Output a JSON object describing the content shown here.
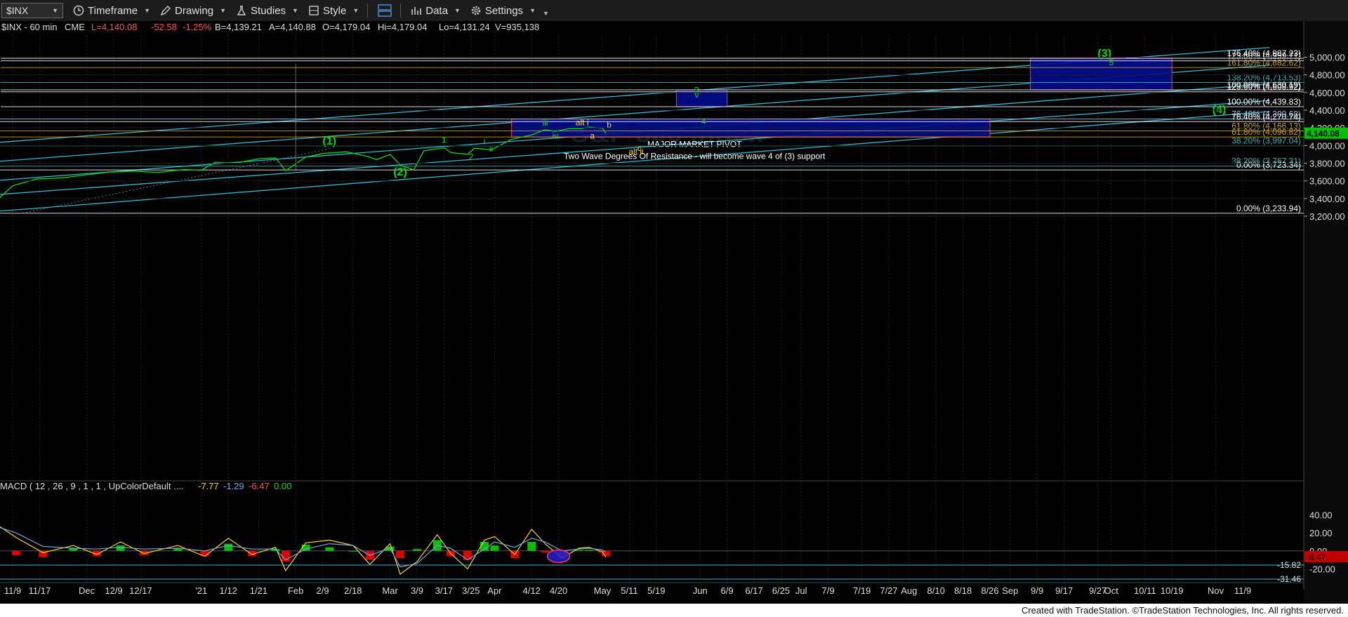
{
  "toolbar": {
    "symbol": "$INX",
    "timeframe": "Timeframe",
    "drawing": "Drawing",
    "studies": "Studies",
    "style": "Style",
    "data": "Data",
    "settings": "Settings"
  },
  "header": {
    "symbol": "$INX - 60 min",
    "exchange": "CME",
    "last": "L=4,140.08",
    "change": "-52.58",
    "pct": "-1.25%",
    "bid": "B=4,139.21",
    "ask": "A=4,140.88",
    "open": "O=4,179.04",
    "high": "Hi=4,179.04",
    "low": "Lo=4,131.24",
    "volume": "V=935,138"
  },
  "watermark": "S&P 500 Index",
  "current_price": "4,140.08",
  "footer": "Created with TradeStation. ©TradeStation Technologies, Inc. All rights reserved.",
  "chart_data": {
    "type": "line",
    "instrument": "$INX",
    "interval": "60 min",
    "ylim": [
      3130,
      5090
    ],
    "y_ticks": [
      "5,000.00",
      "4,800.00",
      "4,600.00",
      "4,400.00",
      "4,200.00",
      "4,000.00",
      "3,800.00",
      "3,600.00",
      "3,400.00",
      "3,200.00"
    ],
    "x_ticks": [
      "11/9",
      "11/17",
      "Dec",
      "12/9",
      "12/17",
      "'21",
      "1/12",
      "1/21",
      "Feb",
      "2/9",
      "2/18",
      "Mar",
      "3/9",
      "3/17",
      "3/25",
      "Apr",
      "4/12",
      "4/20",
      "May",
      "5/11",
      "5/19",
      "Jun",
      "6/9",
      "6/17",
      "6/25",
      "Jul",
      "7/9",
      "7/19",
      "7/27",
      "Aug",
      "8/10",
      "8/18",
      "8/26",
      "Sep",
      "9/9",
      "9/17",
      "9/27",
      "Oct",
      "10/11",
      "10/19",
      "Nov",
      "11/9"
    ],
    "price_series": {
      "name": "$INX",
      "x_dates": [
        "2020-11-04",
        "2020-11-09",
        "2020-11-16",
        "2020-11-24",
        "2020-12-01",
        "2020-12-08",
        "2020-12-15",
        "2020-12-22",
        "2020-12-30",
        "2021-01-04",
        "2021-01-08",
        "2021-01-14",
        "2021-01-21",
        "2021-01-26",
        "2021-01-29",
        "2021-02-04",
        "2021-02-09",
        "2021-02-16",
        "2021-02-22",
        "2021-02-25",
        "2021-03-01",
        "2021-03-04",
        "2021-03-08",
        "2021-03-11",
        "2021-03-17",
        "2021-03-19",
        "2021-03-24",
        "2021-03-26",
        "2021-03-31",
        "2021-04-06",
        "2021-04-12",
        "2021-04-16",
        "2021-04-19",
        "2021-04-23",
        "2021-04-27",
        "2021-04-29",
        "2021-05-03",
        "2021-05-04"
      ],
      "values": [
        3370,
        3545,
        3620,
        3635,
        3670,
        3700,
        3710,
        3695,
        3730,
        3720,
        3810,
        3800,
        3850,
        3860,
        3715,
        3870,
        3910,
        3930,
        3880,
        3840,
        3900,
        3780,
        3725,
        3940,
        3975,
        3920,
        3900,
        3970,
        3950,
        4070,
        4120,
        4180,
        4160,
        4190,
        4190,
        4210,
        4195,
        4140
      ]
    },
    "horizontal_levels": [
      {
        "label": "176.40% (4,987.23)",
        "value": 4987.23,
        "color": "#ffffff"
      },
      {
        "label": "123.60% (4,959.71)",
        "value": 4959.71,
        "color": "#ffffff"
      },
      {
        "label": "161.80% (4,882.62)",
        "value": 4882.62,
        "color": "#c9a227"
      },
      {
        "label": "138.20% (4,713.53)",
        "value": 4713.53,
        "color": "#33b5b5"
      },
      {
        "label": "100.00% (4,630.19)",
        "value": 4630.19,
        "color": "#ffffff"
      },
      {
        "label": "123.60% (4,608.92)",
        "value": 4608.92,
        "color": "#ffffff"
      },
      {
        "label": "100.00% (4,439.83)",
        "value": 4439.83,
        "color": "#ffffff"
      },
      {
        "label": "76.40% (4,300.68)",
        "value": 4300.68,
        "color": "#9fc5e8"
      },
      {
        "label": "76.40% (4,270.74)",
        "value": 4270.74,
        "color": "#ffffff"
      },
      {
        "label": "61.80% (4,166.13)",
        "value": 4166.13,
        "color": "#c9a227"
      },
      {
        "label": "61.80% (4,096.82)",
        "value": 4096.82,
        "color": "#c9a227"
      },
      {
        "label": "38.20% (3,997.04)",
        "value": 3997.04,
        "color": "#33b5b5"
      },
      {
        "label": "38.20% (3,767.31)",
        "value": 3767.31,
        "color": "#33b5b5"
      },
      {
        "label": "0.00% (3,723.34)",
        "value": 3723.34,
        "color": "#ffffff"
      },
      {
        "label": "0.00% (3,233.94)",
        "value": 3233.94,
        "color": "#ffffff"
      }
    ],
    "zones": [
      {
        "name": "major-pivot-box",
        "date_from": "2021-04-06",
        "date_to": "2021-08-26",
        "y_from": 4096.82,
        "y_to": 4300.68,
        "text1": "MAJOR MARKET PIVOT",
        "text2": "Two Wave Degrees Of Resistance - will become wave 4 of (3) support"
      },
      {
        "name": "wave-3-box",
        "date_from": "2021-05-25",
        "date_to": "2021-06-09",
        "y_from": 4439.83,
        "y_to": 4630.19
      },
      {
        "name": "wave-5-box",
        "date_from": "2021-09-07",
        "date_to": "2021-10-19",
        "y_from": 4630.19,
        "y_to": 4987.23
      }
    ],
    "wave_labels": [
      {
        "text": "(1)",
        "date": "2021-02-11",
        "y": 4010,
        "color": "#00e000"
      },
      {
        "text": "(2)",
        "date": "2021-03-04",
        "y": 3660,
        "color": "#00e000"
      },
      {
        "text": "1",
        "date": "2021-03-17",
        "y": 4030,
        "color": "#00e000"
      },
      {
        "text": "2",
        "date": "2021-03-25",
        "y": 3840,
        "color": "#00e000"
      },
      {
        "text": "i",
        "date": "2021-03-29",
        "y": 4015,
        "color": "#00e000"
      },
      {
        "text": "ii",
        "date": "2021-03-31",
        "y": 3930,
        "color": "#00e000"
      },
      {
        "text": "iii",
        "date": "2021-04-16",
        "y": 4225,
        "color": "#00e000"
      },
      {
        "text": "iv",
        "date": "2021-04-19",
        "y": 4080,
        "color": "#00e000"
      },
      {
        "text": "alt i",
        "date": "2021-04-27",
        "y": 4230,
        "color": "#ffd700"
      },
      {
        "text": "b",
        "date": "2021-05-05",
        "y": 4200,
        "color": "#ffd700"
      },
      {
        "text": "a",
        "date": "2021-04-30",
        "y": 4080,
        "color": "#ffd700"
      },
      {
        "text": "c",
        "date": "2021-05-14",
        "y": 3940,
        "color": "#ffd700"
      },
      {
        "text": "alt ii",
        "date": "2021-05-13",
        "y": 3900,
        "color": "#ffd700"
      },
      {
        "text": "4",
        "date": "2021-06-02",
        "y": 4240,
        "color": "#00e000"
      },
      {
        "text": "3",
        "date": "2021-05-31",
        "y": 4595,
        "color": "#00e000"
      },
      {
        "text": "v",
        "date": "2021-05-31",
        "y": 4545,
        "color": "#00e000"
      },
      {
        "text": "(3)",
        "date": "2021-09-29",
        "y": 5005,
        "color": "#00e000"
      },
      {
        "text": "5",
        "date": "2021-10-01",
        "y": 4910,
        "color": "#00e000"
      },
      {
        "text": "(4)",
        "date": "2021-11-02",
        "y": 4370,
        "color": "#00e000"
      }
    ],
    "channel_lines": [
      {
        "from_date": "2020-11-01",
        "from_y": 4025,
        "to_date": "2021-11-17",
        "to_y": 5110
      },
      {
        "from_date": "2020-11-01",
        "from_y": 3810,
        "to_date": "2021-11-17",
        "to_y": 4910
      },
      {
        "from_date": "2020-11-01",
        "from_y": 3595,
        "to_date": "2021-11-17",
        "to_y": 4700
      },
      {
        "from_date": "2020-11-01",
        "from_y": 3435,
        "to_date": "2021-11-17",
        "to_y": 4510
      },
      {
        "from_date": "2020-11-01",
        "from_y": 3245,
        "to_date": "2021-11-17",
        "to_y": 4385
      }
    ],
    "macd": {
      "label": "MACD ( 12 , 26 , 9 , 1 , 1 , UpColorDefault ....",
      "values": [
        "-7.77",
        "-1.29",
        "-6.47",
        "0.00"
      ],
      "value_colors": [
        "#ffd700",
        "#6fa8dc",
        "#ff4d4d",
        "#00e000"
      ],
      "ylim": [
        -42,
        55
      ],
      "y_ticks": [
        "40.00",
        "20.00",
        "0.00",
        "-20.00"
      ],
      "levels": [
        "-15.82",
        "-31.46"
      ],
      "current_label": "-6.47",
      "x_dates": [
        "2020-11-02",
        "2020-11-10",
        "2020-11-18",
        "2020-11-27",
        "2020-12-04",
        "2020-12-11",
        "2020-12-18",
        "2020-12-28",
        "2021-01-05",
        "2021-01-12",
        "2021-01-19",
        "2021-01-26",
        "2021-01-29",
        "2021-02-04",
        "2021-02-11",
        "2021-02-18",
        "2021-02-23",
        "2021-03-01",
        "2021-03-04",
        "2021-03-09",
        "2021-03-15",
        "2021-03-19",
        "2021-03-24",
        "2021-03-29",
        "2021-04-01",
        "2021-04-07",
        "2021-04-12",
        "2021-04-16",
        "2021-04-21",
        "2021-04-26",
        "2021-04-29",
        "2021-05-03",
        "2021-05-04"
      ],
      "macd_values": [
        35,
        15,
        -2,
        6,
        -4,
        10,
        -3,
        6,
        -6,
        14,
        -4,
        4,
        -22,
        9,
        12,
        6,
        -15,
        8,
        -26,
        -12,
        18,
        -3,
        -20,
        12,
        16,
        -4,
        24,
        8,
        -8,
        3,
        4,
        -1,
        -7
      ],
      "signal_values": [
        30,
        20,
        5,
        3,
        2,
        4,
        2,
        3,
        0,
        6,
        2,
        2,
        -10,
        2,
        8,
        6,
        -5,
        3,
        -18,
        -14,
        6,
        3,
        -10,
        2,
        10,
        4,
        14,
        10,
        0,
        2,
        3,
        1,
        -1
      ],
      "hist_values": [
        5,
        -5,
        -7,
        3,
        -6,
        6,
        -5,
        3,
        -6,
        8,
        -6,
        2,
        -12,
        7,
        4,
        0,
        -10,
        5,
        -8,
        2,
        12,
        -6,
        -10,
        10,
        6,
        -8,
        10,
        -2,
        -8,
        1,
        1,
        -2,
        -6
      ]
    }
  }
}
